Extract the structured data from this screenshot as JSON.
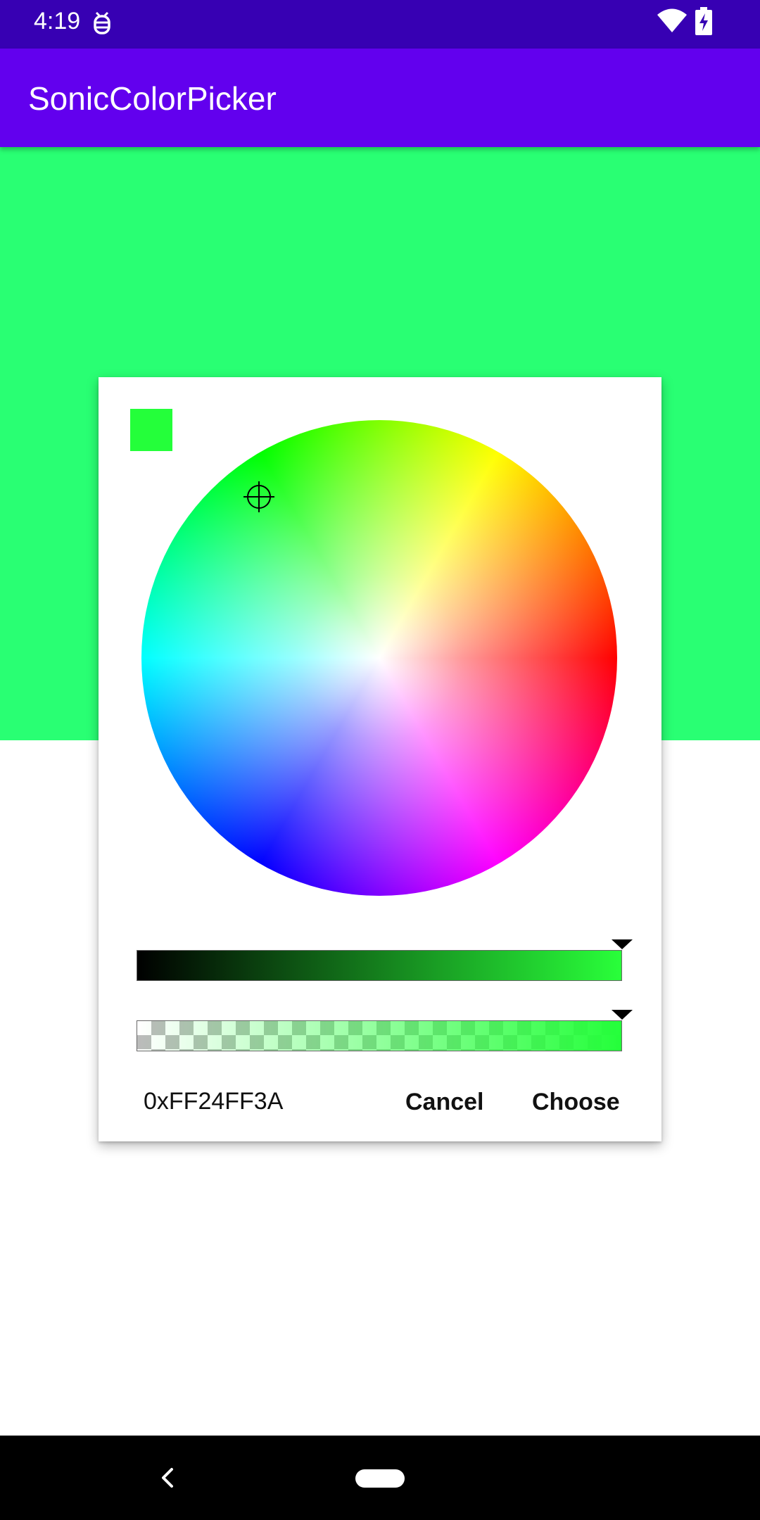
{
  "status_bar": {
    "time": "4:19",
    "icons": [
      "debug-icon",
      "wifi-icon",
      "battery-charging-icon"
    ]
  },
  "app_bar": {
    "title": "SonicColorPicker"
  },
  "colors": {
    "status_bar": "#3700b3",
    "app_bar": "#6200ee",
    "preview_background": "#29ff73",
    "selected_color": "#24ff3a"
  },
  "dialog": {
    "hex_value": "0xFF24FF3A",
    "cancel_label": "Cancel",
    "choose_label": "Choose",
    "brightness_level": 1.0,
    "alpha_level": 1.0
  },
  "nav_bar": {
    "icons": [
      "back-icon",
      "home-pill"
    ]
  }
}
